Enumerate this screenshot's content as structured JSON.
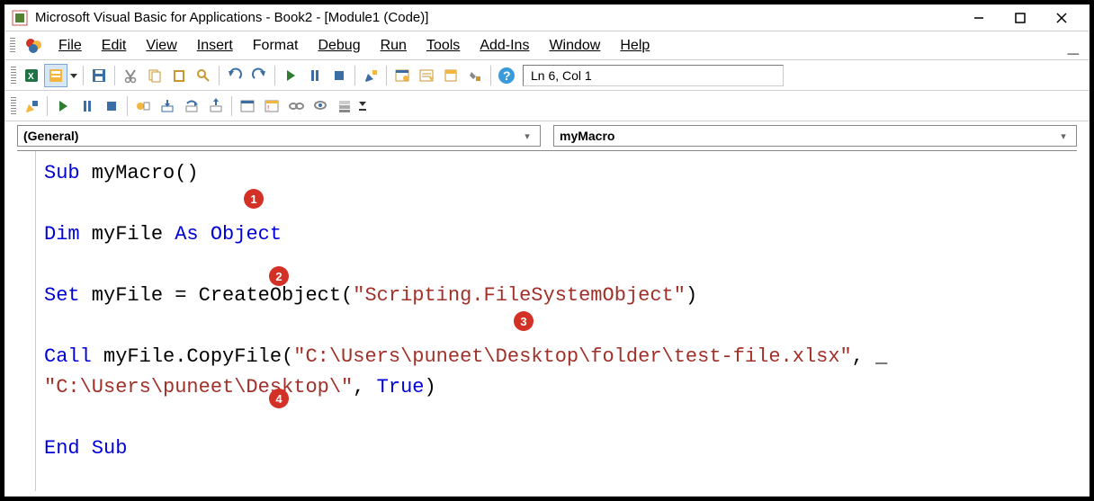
{
  "window": {
    "title": "Microsoft Visual Basic for Applications - Book2 - [Module1 (Code)]"
  },
  "menu": {
    "file": "File",
    "edit": "Edit",
    "view": "View",
    "insert": "Insert",
    "format": "Format",
    "debug": "Debug",
    "run": "Run",
    "tools": "Tools",
    "addins": "Add-Ins",
    "window": "Window",
    "help": "Help"
  },
  "status": {
    "cursor": "Ln 6, Col 1"
  },
  "selectors": {
    "left": "(General)",
    "right": "myMacro"
  },
  "code": {
    "l1a": "Sub",
    "l1b": " myMacro()",
    "l2": " ",
    "l3a": "Dim",
    "l3b": " myFile ",
    "l3c": "As Object",
    "l4": " ",
    "l5a": "Set",
    "l5b": " myFile = CreateObject(",
    "l5c": "\"Scripting.FileSystemObject\"",
    "l5d": ")",
    "l6": " ",
    "l7a": "Call",
    "l7b": " myFile.CopyFile(",
    "l7c": "\"C:\\Users\\puneet\\Desktop\\folder\\test-file.xlsx\"",
    "l7d": ", _",
    "l8a": "\"C:\\Users\\puneet\\Desktop\\\"",
    "l8b": ", ",
    "l8c": "True",
    "l8d": ")",
    "l9": " ",
    "l10": "End Sub"
  },
  "callouts": {
    "c1": "1",
    "c2": "2",
    "c3": "3",
    "c4": "4"
  }
}
